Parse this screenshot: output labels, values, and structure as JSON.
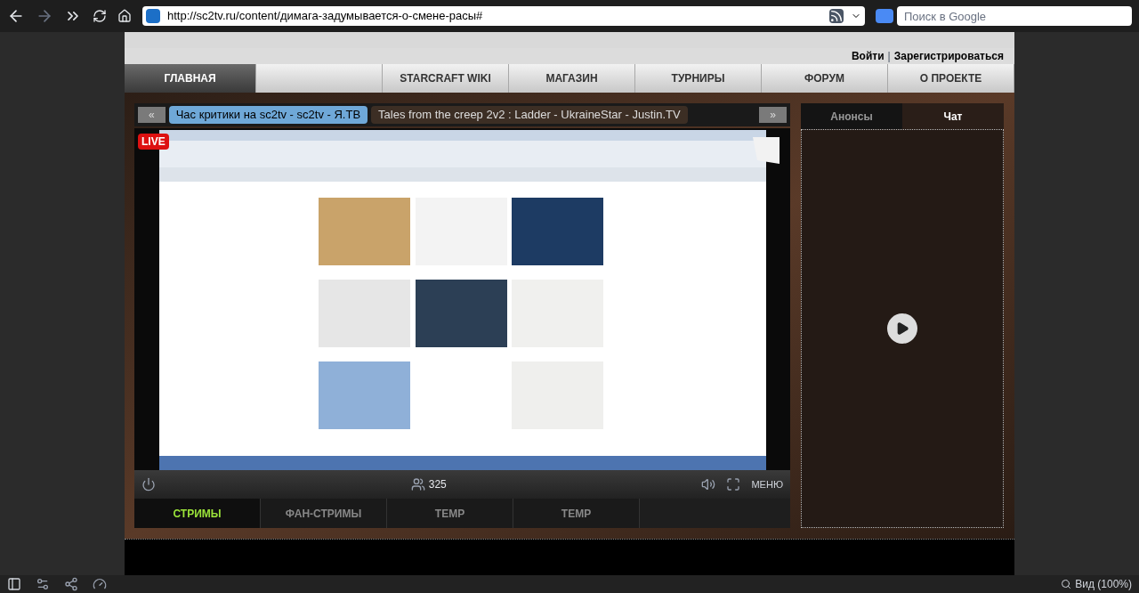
{
  "browser": {
    "url": "http://sc2tv.ru/content/димага-задумывается-о-смене-расы#",
    "search_placeholder": "Поиск в Google"
  },
  "site": {
    "auth_links": [
      "Войти",
      "Зарегистрироваться"
    ],
    "auth_separator": "|",
    "nav": [
      {
        "label": "ГЛАВНАЯ",
        "selected": true
      },
      {
        "label": "STARCRAFT WIKI",
        "selected": false
      },
      {
        "label": "МАГАЗИН",
        "selected": false
      },
      {
        "label": "ТУРНИРЫ",
        "selected": false
      },
      {
        "label": "ФОРУМ",
        "selected": false
      },
      {
        "label": "О ПРОЕКТЕ",
        "selected": false
      }
    ],
    "stream_list": {
      "prev": "«",
      "next": "»",
      "items": [
        {
          "label": "Час критики на sc2tv - sc2tv - Я.ТВ",
          "selected": true
        },
        {
          "label": "Tales from the creep 2v2 : Ladder - UkraineStar - Justin.TV",
          "selected": false
        }
      ]
    },
    "player": {
      "badge": "LIVE",
      "viewers": "325",
      "menu": "МЕНЮ"
    },
    "stream_tabs": [
      {
        "label": "СТРИМЫ",
        "selected": true
      },
      {
        "label": "ФАН-СТРИМЫ",
        "selected": false
      },
      {
        "label": "TEMP",
        "selected": false
      },
      {
        "label": "TEMP",
        "selected": false
      }
    ],
    "side_tabs": [
      {
        "label": "Анонсы",
        "selected": false
      },
      {
        "label": "Чат",
        "selected": true
      }
    ]
  },
  "status_bar": {
    "zoom": "Вид (100%)"
  }
}
